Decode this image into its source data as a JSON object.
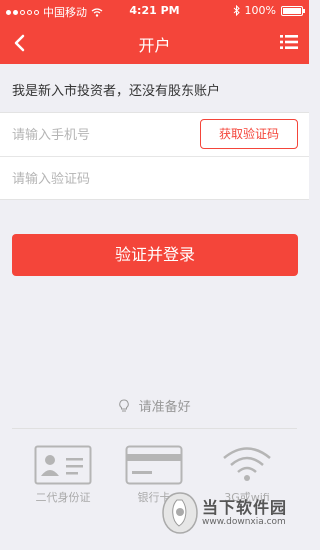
{
  "status_bar": {
    "carrier": "中国移动",
    "time": "4:21 PM",
    "battery": "100%",
    "battery_level": 1.0,
    "signal_bars_filled": 2,
    "signal_bars_total": 5
  },
  "header": {
    "title": "开户",
    "back_icon": "chevron-left-icon",
    "menu_icon": "list-menu-icon"
  },
  "intro_text": "我是新入市投资者，还没有股东账户",
  "form": {
    "phone_placeholder": "请输入手机号",
    "phone_value": "",
    "code_placeholder": "请输入验证码",
    "code_value": "",
    "get_code_label": "获取验证码"
  },
  "login_button": "验证并登录",
  "prepare": {
    "label": "请准备好",
    "items": [
      {
        "label": "二代身份证",
        "icon": "id-card-icon"
      },
      {
        "label": "银行卡",
        "icon": "bank-card-icon"
      },
      {
        "label": "3G或wifi",
        "icon": "wifi-icon"
      }
    ]
  },
  "watermark": {
    "name": "当下软件园",
    "url": "www.downxia.com"
  },
  "colors": {
    "accent": "#f4453a",
    "background": "#efeff4",
    "muted": "#aaaaaa"
  }
}
